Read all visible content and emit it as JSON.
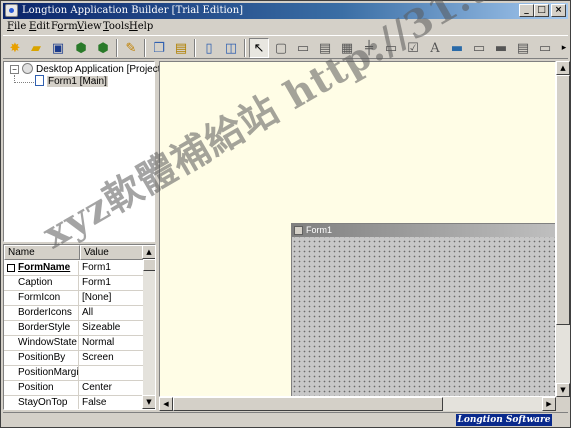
{
  "window": {
    "title": "Longtion Application Builder [Trial Edition]",
    "minimize": "_",
    "maximize": "□",
    "close": "×"
  },
  "menu": [
    {
      "label": "File",
      "accel": "F",
      "rest": "ile"
    },
    {
      "label": "Edit",
      "accel": "E",
      "rest": "dit"
    },
    {
      "label": "Form",
      "accel": "o",
      "pre": "F",
      "rest": "rm"
    },
    {
      "label": "View",
      "accel": "V",
      "rest": "iew"
    },
    {
      "label": "Tools",
      "accel": "T",
      "rest": "ools"
    },
    {
      "label": "Help",
      "accel": "H",
      "rest": "elp"
    }
  ],
  "toolbar_icons": [
    "new-icon",
    "open-folder-icon",
    "save-icon",
    "build-icon",
    "run-icon",
    "wizard-icon",
    "copy-icon",
    "paste-icon",
    "page-icon",
    "preview-icon",
    "pointer-icon",
    "form-icon",
    "panel-icon",
    "text-icon",
    "grid-icon",
    "splitter-icon",
    "button-icon",
    "checkbox-icon",
    "label-icon",
    "image-icon",
    "edit-icon",
    "more-icon"
  ],
  "tree": {
    "project": "Desktop Application [Project]",
    "form": "Form1 [Main]"
  },
  "props": {
    "header_name": "Name",
    "header_value": "Value",
    "rows": [
      {
        "name": "FormName",
        "value": "Form1"
      },
      {
        "name": "Caption",
        "value": "Form1"
      },
      {
        "name": "FormIcon",
        "value": "[None]"
      },
      {
        "name": "BorderIcons",
        "value": "All"
      },
      {
        "name": "BorderStyle",
        "value": "Sizeable"
      },
      {
        "name": "WindowState",
        "value": "Normal"
      },
      {
        "name": "PositionBy",
        "value": "Screen"
      },
      {
        "name": "PositionMargin",
        "value": ""
      },
      {
        "name": "Position",
        "value": "Center"
      },
      {
        "name": "StayOnTop",
        "value": "False"
      }
    ]
  },
  "designer": {
    "form_title": "Form1"
  },
  "status": {
    "brand": "Longtion Software"
  },
  "watermark": "xyz軟體補給站 http://31.to",
  "colors": {
    "titlebar": "#0a246a",
    "designer_bg": "#fffde6",
    "brand_bg": "#0a2a8c"
  }
}
